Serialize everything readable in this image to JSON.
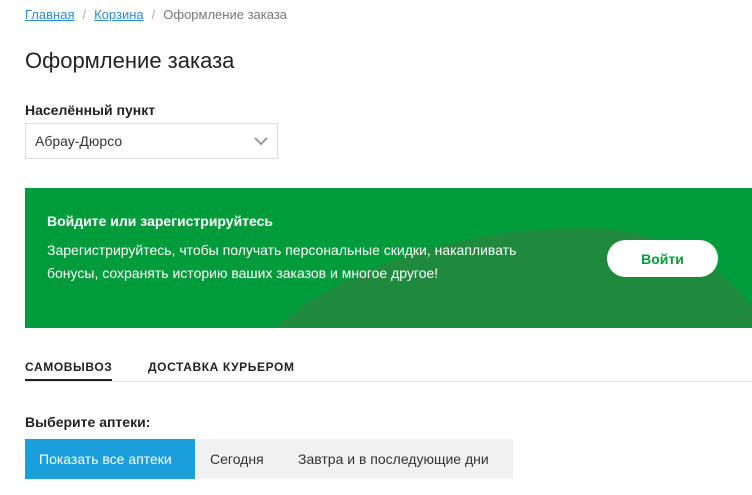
{
  "breadcrumb": {
    "items": [
      "Главная",
      "Корзина"
    ],
    "separator": "/",
    "current": "Оформление заказа"
  },
  "page": {
    "title": "Оформление заказа"
  },
  "city": {
    "label": "Населённый пункт",
    "selected": "Абрау-Дюрсо"
  },
  "promo": {
    "title": "Войдите или зарегистрируйтесь",
    "text": "Зарегистрируйтесь, чтобы получать персональные скидки, накапливать бонусы, сохранять историю ваших заказов и многое другое!",
    "button_label": "Войти",
    "background_color": "#009b3a"
  },
  "tabs": [
    {
      "label": "САМОВЫВОЗ",
      "active": true
    },
    {
      "label": "ДОСТАВКА КУРЬЕРОМ",
      "active": false
    }
  ],
  "pharmacies": {
    "label": "Выберите аптеки:",
    "filters": [
      {
        "label": "Показать все аптеки",
        "active": true
      },
      {
        "label": "Сегодня",
        "active": false
      },
      {
        "label": "Завтра и в последующие дни",
        "active": false
      }
    ]
  },
  "colors": {
    "link": "#2a8bd4",
    "accent_green": "#009b3a",
    "accent_blue": "#1a9fdb"
  }
}
